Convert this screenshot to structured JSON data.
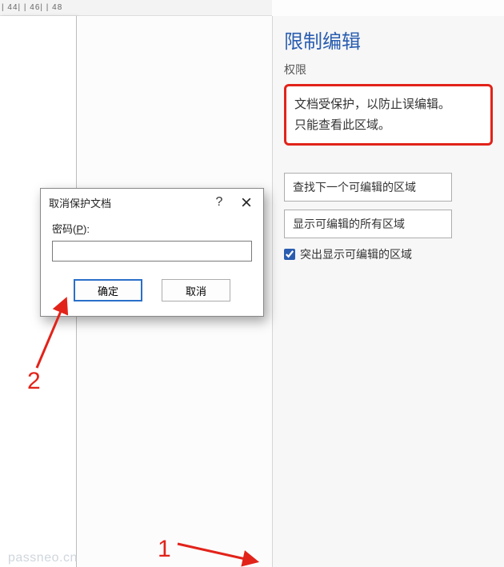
{
  "ruler": {
    "marks": "| 44|   | 46|   | 48"
  },
  "pane": {
    "title": "限制编辑",
    "sub": "权限",
    "notice_line1": "文档受保护，以防止误编辑。",
    "notice_line2": "只能查看此区域。",
    "btn_find_next": "查找下一个可编辑的区域",
    "btn_show_all": "显示可编辑的所有区域",
    "chk_highlight": "突出显示可编辑的区域",
    "chk_checked": true
  },
  "dialog": {
    "title": "取消保护文档",
    "help": "?",
    "label_before": "密码(",
    "label_hotkey": "P",
    "label_after": "):",
    "ok": "确定",
    "cancel": "取消",
    "value": ""
  },
  "annotations": {
    "one": "1",
    "two": "2"
  },
  "watermark": "passneo.cn"
}
